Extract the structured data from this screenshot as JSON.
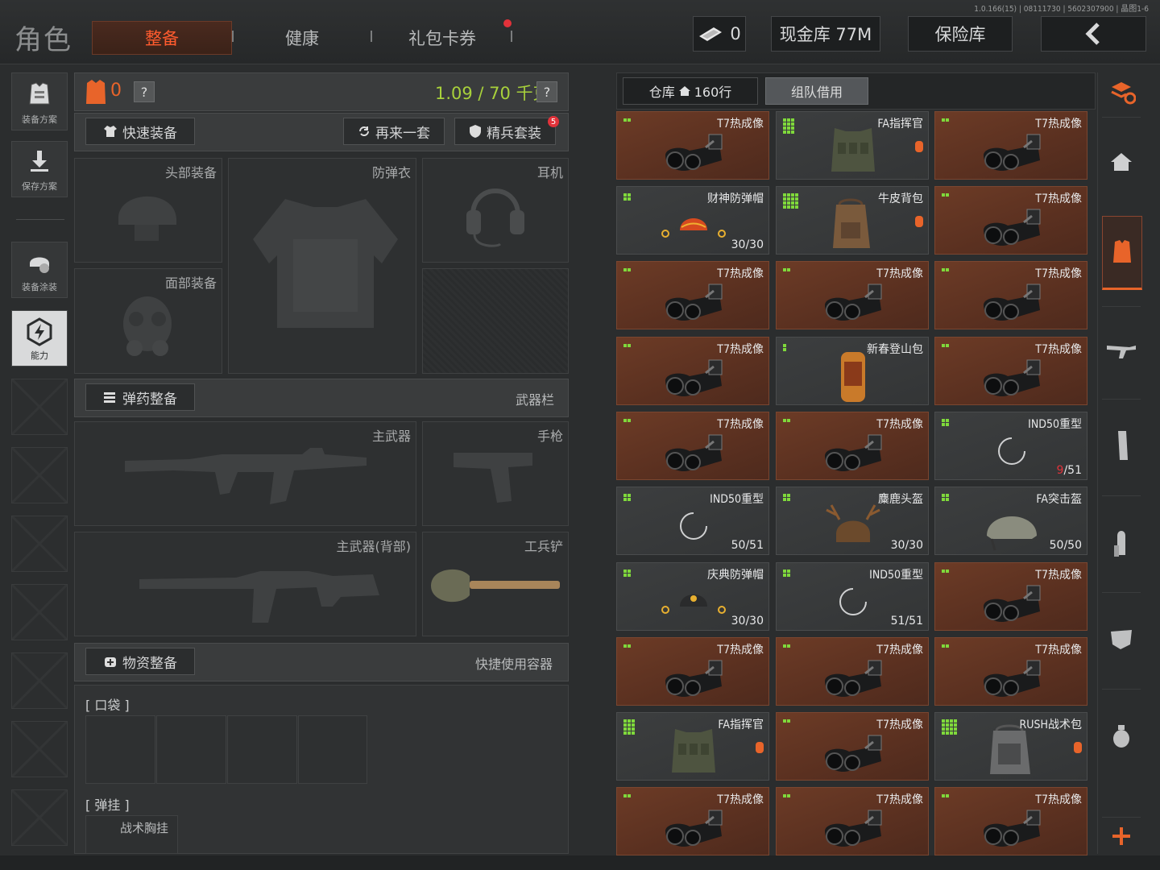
{
  "version": "1.0.166(15) | 08111730 | 5602307900 | 晶图1-6",
  "page_title": "角色",
  "tabs": {
    "equip": "整备",
    "health": "健康",
    "gift": "礼包卡券"
  },
  "top": {
    "currency": "0",
    "cash": "现金库 77M",
    "vault": "保险库"
  },
  "sidebar": {
    "plan": "装备方案",
    "save": "保存方案",
    "paint": "装备涂装",
    "ability": "能力"
  },
  "loadout": {
    "armor_count": "0",
    "help": "?",
    "weight": "1.09 / 70 千克",
    "quick_equip": "快速装备",
    "again": "再来一套",
    "elite": "精兵套装",
    "elite_badge": "5",
    "slots": {
      "head": "头部装备",
      "vest": "防弹衣",
      "ear": "耳机",
      "face": "面部装备",
      "primary": "主武器",
      "pistol": "手枪",
      "primary_back": "主武器(背部)",
      "shovel": "工兵铲"
    },
    "ammo_btn": "弹药整备",
    "weapon_bar": "武器栏",
    "supply_btn": "物资整备",
    "quick_container": "快捷使用容器",
    "pocket": "[ 口袋 ]",
    "rig": "[ 弹挂 ]",
    "rig_item": "战术胸挂"
  },
  "inventory": {
    "tab_warehouse": "仓库",
    "tab_warehouse_rows": "160行",
    "tab_team": "组队借用",
    "items": [
      {
        "name": "T7热成像",
        "count": "",
        "rarity": "rare",
        "icon": "thermal",
        "size": [
          2,
          1
        ]
      },
      {
        "name": "FA指挥官",
        "count": "",
        "rarity": "normal",
        "icon": "vest",
        "size": [
          3,
          4
        ],
        "badge": true
      },
      {
        "name": "T7热成像",
        "count": "",
        "rarity": "rare",
        "icon": "thermal",
        "size": [
          2,
          1
        ]
      },
      {
        "name": "财神防弹帽",
        "count": "30/30",
        "rarity": "normal",
        "icon": "cap",
        "size": [
          2,
          2
        ]
      },
      {
        "name": "牛皮背包",
        "count": "",
        "rarity": "normal",
        "icon": "backpack",
        "size": [
          4,
          4
        ],
        "badge": true
      },
      {
        "name": "T7热成像",
        "count": "",
        "rarity": "rare",
        "icon": "thermal",
        "size": [
          2,
          1
        ]
      },
      {
        "name": "T7热成像",
        "count": "",
        "rarity": "rare",
        "icon": "thermal",
        "size": [
          2,
          1
        ]
      },
      {
        "name": "T7热成像",
        "count": "",
        "rarity": "rare",
        "icon": "thermal",
        "size": [
          2,
          1
        ]
      },
      {
        "name": "T7热成像",
        "count": "",
        "rarity": "rare",
        "icon": "thermal",
        "size": [
          2,
          1
        ]
      },
      {
        "name": "T7热成像",
        "count": "",
        "rarity": "rare",
        "icon": "thermal",
        "size": [
          2,
          1
        ]
      },
      {
        "name": "新春登山包",
        "count": "",
        "rarity": "normal",
        "icon": "pack2",
        "size": [
          1,
          2
        ]
      },
      {
        "name": "T7热成像",
        "count": "",
        "rarity": "rare",
        "icon": "thermal",
        "size": [
          2,
          1
        ]
      },
      {
        "name": "T7热成像",
        "count": "",
        "rarity": "rare",
        "icon": "thermal",
        "size": [
          2,
          1
        ]
      },
      {
        "name": "T7热成像",
        "count": "",
        "rarity": "rare",
        "icon": "thermal",
        "size": [
          2,
          1
        ]
      },
      {
        "name": "IND50重型",
        "count": "9/51",
        "countRed": "9",
        "countRest": "/51",
        "rarity": "normal",
        "icon": "loading",
        "size": [
          2,
          2
        ]
      },
      {
        "name": "IND50重型",
        "count": "50/51",
        "rarity": "normal",
        "icon": "loading",
        "size": [
          2,
          2
        ]
      },
      {
        "name": "麋鹿头盔",
        "count": "30/30",
        "rarity": "normal",
        "icon": "helmet-elk",
        "size": [
          2,
          2
        ]
      },
      {
        "name": "FA突击盔",
        "count": "50/50",
        "rarity": "normal",
        "icon": "helmet",
        "size": [
          2,
          2
        ]
      },
      {
        "name": "庆典防弹帽",
        "count": "30/30",
        "rarity": "normal",
        "icon": "cap2",
        "size": [
          2,
          2
        ]
      },
      {
        "name": "IND50重型",
        "count": "51/51",
        "rarity": "normal",
        "icon": "loading",
        "size": [
          2,
          2
        ]
      },
      {
        "name": "T7热成像",
        "count": "",
        "rarity": "rare",
        "icon": "thermal",
        "size": [
          2,
          1
        ]
      },
      {
        "name": "T7热成像",
        "count": "",
        "rarity": "rare",
        "icon": "thermal",
        "size": [
          2,
          1
        ]
      },
      {
        "name": "T7热成像",
        "count": "",
        "rarity": "rare",
        "icon": "thermal",
        "size": [
          2,
          1
        ]
      },
      {
        "name": "T7热成像",
        "count": "",
        "rarity": "rare",
        "icon": "thermal",
        "size": [
          2,
          1
        ]
      },
      {
        "name": "FA指挥官",
        "count": "",
        "rarity": "normal",
        "icon": "vest",
        "size": [
          3,
          4
        ],
        "badge": true
      },
      {
        "name": "T7热成像",
        "count": "",
        "rarity": "rare",
        "icon": "thermal",
        "size": [
          2,
          1
        ]
      },
      {
        "name": "RUSH战术包",
        "count": "",
        "rarity": "normal",
        "icon": "backpack2",
        "size": [
          4,
          4
        ],
        "badge": true
      },
      {
        "name": "T7热成像",
        "count": "",
        "rarity": "rare",
        "icon": "thermal",
        "size": [
          2,
          1
        ]
      },
      {
        "name": "T7热成像",
        "count": "",
        "rarity": "rare",
        "icon": "thermal",
        "size": [
          2,
          1
        ]
      },
      {
        "name": "T7热成像",
        "count": "",
        "rarity": "rare",
        "icon": "thermal",
        "size": [
          2,
          1
        ]
      }
    ]
  },
  "colors": {
    "accent": "#ff5b2e",
    "weight_green": "#a8d13b",
    "rare_bg": "#6c3b26",
    "badge_red": "#e2323a"
  }
}
